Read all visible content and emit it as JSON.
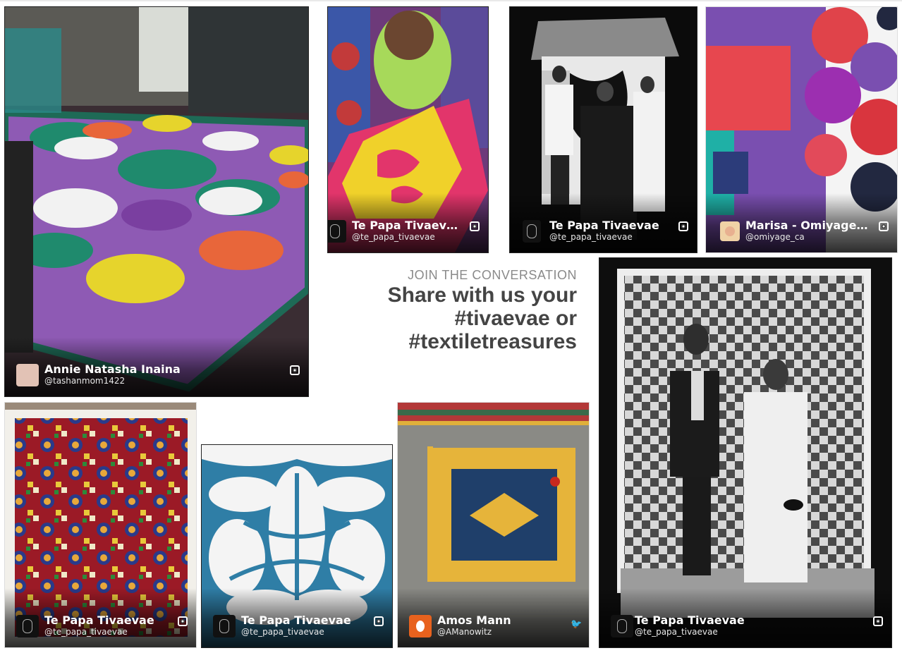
{
  "join": {
    "eyebrow": "JOIN THE CONVERSATION",
    "line1": "Share with us your",
    "line2": "#tivaevae or",
    "line3": "#textiletreasures"
  },
  "posts": [
    {
      "name": "Annie Natasha Inaina",
      "handle": "@tashanmom1422",
      "network": "instagram-icon"
    },
    {
      "name": "Te Papa Tivaevae",
      "handle": "@te_papa_tivaevae",
      "network": "instagram-icon"
    },
    {
      "name": "Te Papa Tivaevae",
      "handle": "@te_papa_tivaevae",
      "network": "instagram-icon"
    },
    {
      "name": "Marisa - Omiyage…",
      "handle": "@omiyage_ca",
      "network": "instagram-icon"
    },
    {
      "name": "Te Papa Tivaevae",
      "handle": "@te_papa_tivaevae",
      "network": "instagram-icon"
    },
    {
      "name": "Te Papa Tivaevae",
      "handle": "@te_papa_tivaevae",
      "network": "instagram-icon"
    },
    {
      "name": "Amos Mann",
      "handle": "@AManowitz",
      "network": "twitter-icon"
    },
    {
      "name": "Te Papa Tivaevae",
      "handle": "@te_papa_tivaevae",
      "network": "instagram-icon"
    }
  ],
  "colors": {
    "heading": "#444444",
    "eyebrow": "#8a8a8a",
    "caption_text": "#ffffff"
  }
}
